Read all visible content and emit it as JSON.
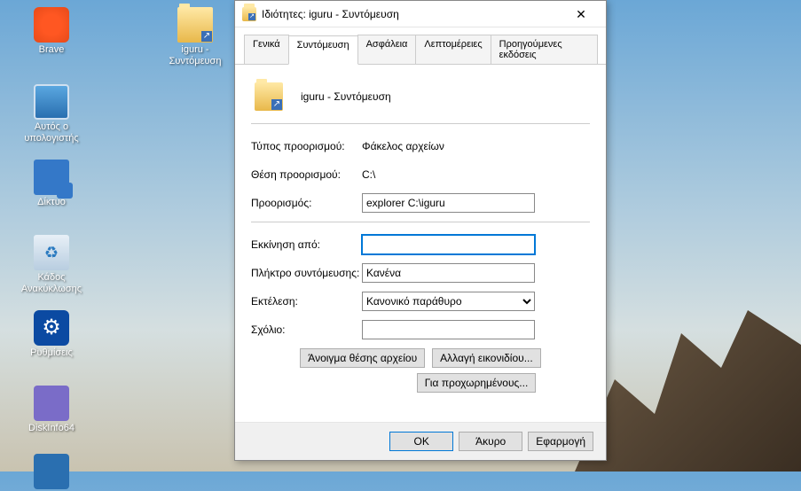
{
  "desktop": {
    "icons": {
      "brave": "Brave",
      "iguru": "iguru - Συντόμευση",
      "pc": "Αυτός ο υπολογιστής",
      "net": "Δίκτυο",
      "bin": "Κάδος Ανακύκλωσης",
      "settings": "Ρυθμίσεις",
      "disk": "DiskInfo64"
    }
  },
  "dialog": {
    "title": "Ιδιότητες: iguru - Συντόμευση",
    "tabs": {
      "general": "Γενικά",
      "shortcut": "Συντόμευση",
      "security": "Ασφάλεια",
      "details": "Λεπτομέρειες",
      "previous": "Προηγούμενες εκδόσεις"
    },
    "header_name": "iguru - Συντόμευση",
    "labels": {
      "target_type": "Τύπος προορισμού:",
      "target_location": "Θέση προορισμού:",
      "target": "Προορισμός:",
      "start_in": "Εκκίνηση από:",
      "shortcut_key": "Πλήκτρο συντόμευσης:",
      "run": "Εκτέλεση:",
      "comment": "Σχόλιο:"
    },
    "values": {
      "target_type": "Φάκελος αρχείων",
      "target_location": "C:\\",
      "target": "explorer C:\\iguru",
      "start_in": "",
      "shortcut_key": "Κανένα",
      "run": "Κανονικό παράθυρο",
      "comment": ""
    },
    "buttons": {
      "open_location": "Άνοιγμα θέσης αρχείου",
      "change_icon": "Αλλαγή εικονιδίου...",
      "advanced": "Για προχωρημένους...",
      "ok": "OK",
      "cancel": "Άκυρο",
      "apply": "Εφαρμογή"
    }
  }
}
